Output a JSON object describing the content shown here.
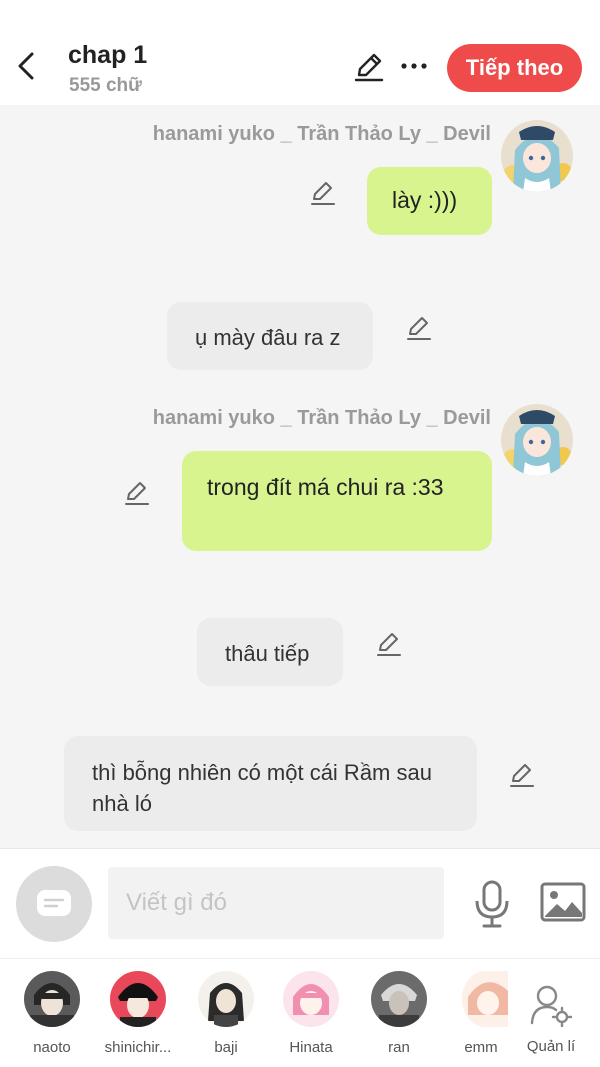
{
  "header": {
    "title": "chap 1",
    "word_count": "555 chữ",
    "next_label": "Tiếp theo",
    "accent_color": "#f04b4b"
  },
  "messages": [
    {
      "type": "character",
      "sender": "hanami yuko _ Trần Thảo Ly _ Devil",
      "text": "lày :)))"
    },
    {
      "type": "narration",
      "text": "ụ mày đâu ra z"
    },
    {
      "type": "character",
      "sender": "hanami yuko _ Trần Thảo Ly _ Devil",
      "text": "trong đít má chui ra :33"
    },
    {
      "type": "narration",
      "text": "thâu tiếp"
    },
    {
      "type": "narration",
      "text": "thì bỗng nhiên có một cái Rầm sau nhà ló"
    }
  ],
  "input": {
    "placeholder": "Viết gì đó"
  },
  "characters": [
    {
      "name": "naoto"
    },
    {
      "name": "shinichir..."
    },
    {
      "name": "baji"
    },
    {
      "name": "Hinata"
    },
    {
      "name": "ran"
    },
    {
      "name": "emm"
    }
  ],
  "manage_label": "Quản lí",
  "colors": {
    "my_bubble": "#d7f48f",
    "other_bubble": "#ececec"
  }
}
